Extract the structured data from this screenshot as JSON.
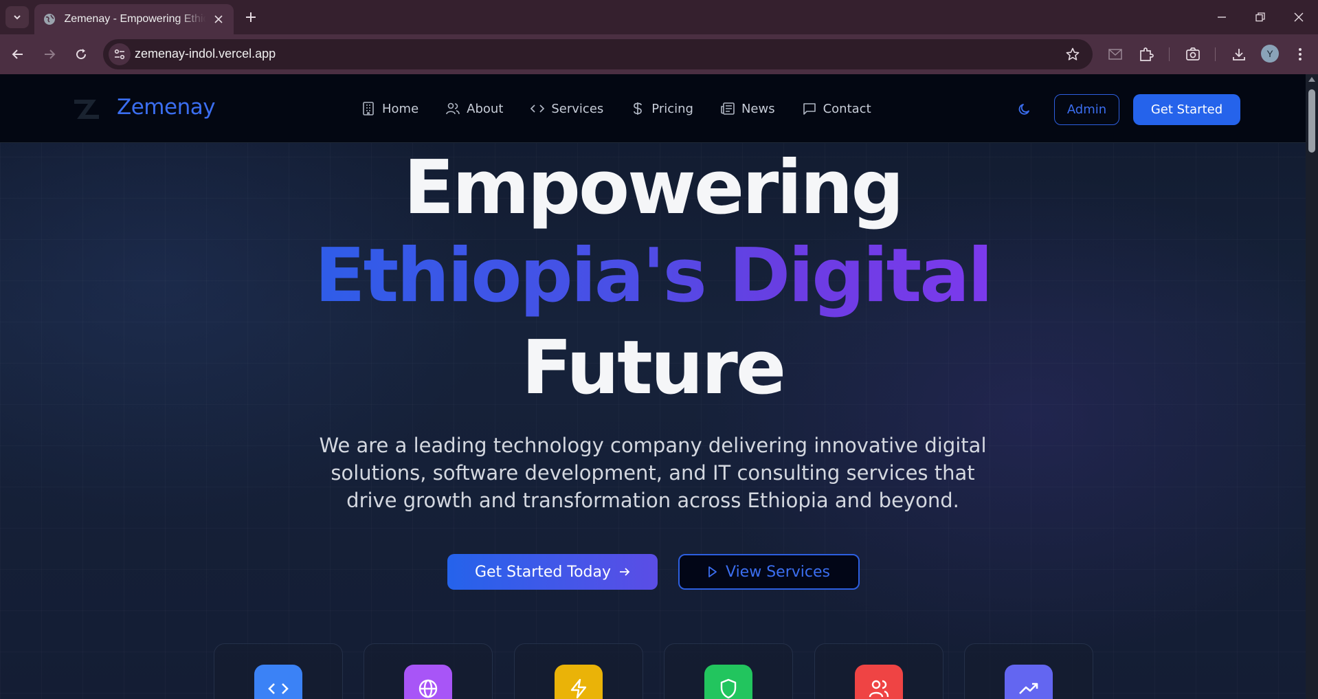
{
  "browser": {
    "tab_title": "Zemenay - Empowering Ethiopia's Digital Future",
    "url": "zemenay-indol.vercel.app",
    "profile_initial": "Y"
  },
  "site": {
    "brand": "Zemenay",
    "nav": [
      {
        "label": "Home",
        "icon": "building-icon"
      },
      {
        "label": "About",
        "icon": "users-icon"
      },
      {
        "label": "Services",
        "icon": "code-icon"
      },
      {
        "label": "Pricing",
        "icon": "dollar-icon"
      },
      {
        "label": "News",
        "icon": "newspaper-icon"
      },
      {
        "label": "Contact",
        "icon": "message-icon"
      }
    ],
    "admin_label": "Admin",
    "get_started_label": "Get Started"
  },
  "hero": {
    "line1": "Empowering",
    "line2": "Ethiopia's Digital",
    "line3": "Future",
    "subtitle_1": "We are a leading technology company delivering innovative digital",
    "subtitle_2": "solutions, software development, and IT consulting services that",
    "subtitle_3": "drive growth and transformation across Ethiopia and beyond.",
    "cta_primary": "Get Started Today",
    "cta_secondary": "View Services"
  },
  "feature_icons": [
    {
      "icon": "code-icon",
      "color": "#3b82f6"
    },
    {
      "icon": "globe-icon",
      "color": "#a855f7"
    },
    {
      "icon": "lightning-icon",
      "color": "#eab308"
    },
    {
      "icon": "shield-icon",
      "color": "#22c55e"
    },
    {
      "icon": "users-icon",
      "color": "#ef4444"
    },
    {
      "icon": "trending-up-icon",
      "color": "#6366f1"
    }
  ],
  "colors": {
    "accent": "#2563eb",
    "gradient_end": "#7c3aed",
    "header_bg": "#030712"
  }
}
